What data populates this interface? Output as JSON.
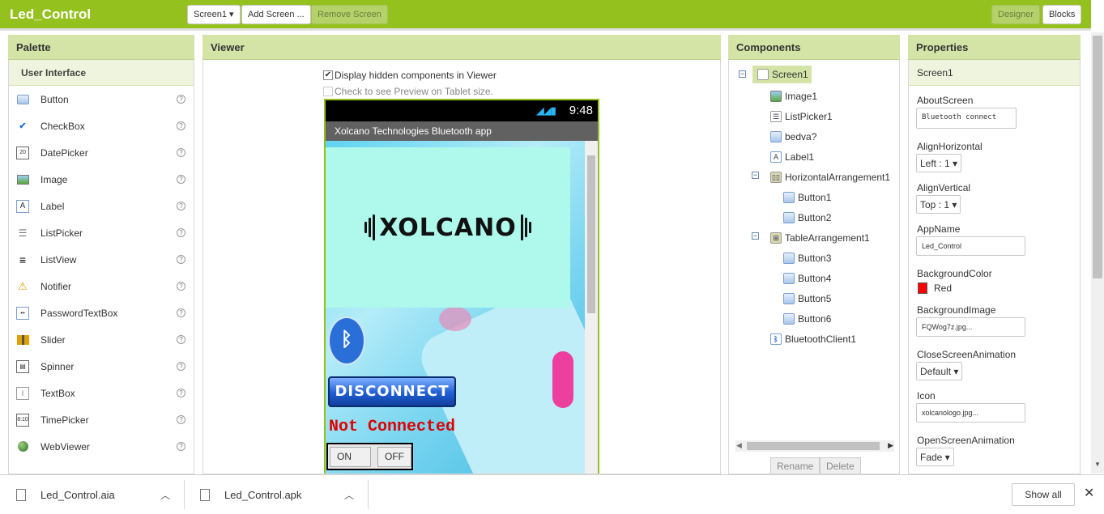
{
  "topbar": {
    "app_title": "Led_Control",
    "screen_select": "Screen1 ▾",
    "add_screen": "Add Screen ...",
    "remove_screen": "Remove Screen",
    "designer": "Designer",
    "blocks": "Blocks"
  },
  "palette": {
    "title": "Palette",
    "category": "User Interface",
    "items": [
      {
        "label": "Button",
        "icon": "button-icon"
      },
      {
        "label": "CheckBox",
        "icon": "checkbox-icon"
      },
      {
        "label": "DatePicker",
        "icon": "datepicker-icon"
      },
      {
        "label": "Image",
        "icon": "image-icon"
      },
      {
        "label": "Label",
        "icon": "label-icon"
      },
      {
        "label": "ListPicker",
        "icon": "listpicker-icon"
      },
      {
        "label": "ListView",
        "icon": "listview-icon"
      },
      {
        "label": "Notifier",
        "icon": "notifier-icon"
      },
      {
        "label": "PasswordTextBox",
        "icon": "password-icon"
      },
      {
        "label": "Slider",
        "icon": "slider-icon"
      },
      {
        "label": "Spinner",
        "icon": "spinner-icon"
      },
      {
        "label": "TextBox",
        "icon": "textbox-icon"
      },
      {
        "label": "TimePicker",
        "icon": "timepicker-icon"
      },
      {
        "label": "WebViewer",
        "icon": "webviewer-icon"
      }
    ],
    "help": "?"
  },
  "viewer": {
    "title": "Viewer",
    "display_hidden": "Display hidden components in Viewer",
    "display_hidden_checked": true,
    "tablet_preview": "Check to see Preview on Tablet size.",
    "tablet_preview_checked": false,
    "phone": {
      "time": "9:48",
      "app_title": "Xolcano Technologies Bluetooth app",
      "logo_text": "XOLCANO",
      "disconnect": "DISCONNECT",
      "status": "Not Connected",
      "on": "ON",
      "off": "OFF"
    }
  },
  "components": {
    "title": "Components",
    "tree": [
      {
        "label": "Screen1",
        "level": 0,
        "toggle": "−",
        "icon": "screen-icon"
      },
      {
        "label": "Image1",
        "level": 1,
        "icon": "image-icon"
      },
      {
        "label": "ListPicker1",
        "level": 1,
        "icon": "listpicker-icon"
      },
      {
        "label": "bedva?",
        "level": 1,
        "icon": "button-icon"
      },
      {
        "label": "Label1",
        "level": 1,
        "icon": "label-icon"
      },
      {
        "label": "HorizontalArrangement1",
        "level": 1,
        "toggle": "−",
        "icon": "horizontal-arrangement-icon"
      },
      {
        "label": "Button1",
        "level": 2,
        "icon": "button-icon"
      },
      {
        "label": "Button2",
        "level": 2,
        "icon": "button-icon"
      },
      {
        "label": "TableArrangement1",
        "level": 1,
        "toggle": "−",
        "icon": "table-arrangement-icon"
      },
      {
        "label": "Button3",
        "level": 2,
        "icon": "button-icon"
      },
      {
        "label": "Button4",
        "level": 2,
        "icon": "button-icon"
      },
      {
        "label": "Button5",
        "level": 2,
        "icon": "button-icon"
      },
      {
        "label": "Button6",
        "level": 2,
        "icon": "button-icon"
      },
      {
        "label": "BluetoothClient1",
        "level": 1,
        "icon": "bluetooth-icon"
      }
    ],
    "rename": "Rename",
    "delete": "Delete"
  },
  "properties": {
    "title": "Properties",
    "screen": "Screen1",
    "about_screen_label": "AboutScreen",
    "about_screen_value": "Bluetooth connect",
    "align_h_label": "AlignHorizontal",
    "align_h_value": "Left : 1 ▾",
    "align_v_label": "AlignVertical",
    "align_v_value": "Top : 1 ▾",
    "app_name_label": "AppName",
    "app_name_value": "Led_Control",
    "bg_color_label": "BackgroundColor",
    "bg_color_value": "Red",
    "bg_color_hex": "#ff0000",
    "bg_image_label": "BackgroundImage",
    "bg_image_value": "FQWog7z.jpg...",
    "close_anim_label": "CloseScreenAnimation",
    "close_anim_value": "Default ▾",
    "icon_label": "Icon",
    "icon_value": "xolcanologo.jpg...",
    "open_anim_label": "OpenScreenAnimation",
    "open_anim_value": "Fade ▾"
  },
  "downloads": {
    "items": [
      "Led_Control.aia",
      "Led_Control.apk"
    ],
    "show_all": "Show all",
    "close": "✕"
  },
  "colors": {
    "accent": "#95c11f",
    "panel_header": "#d4e4a7"
  }
}
